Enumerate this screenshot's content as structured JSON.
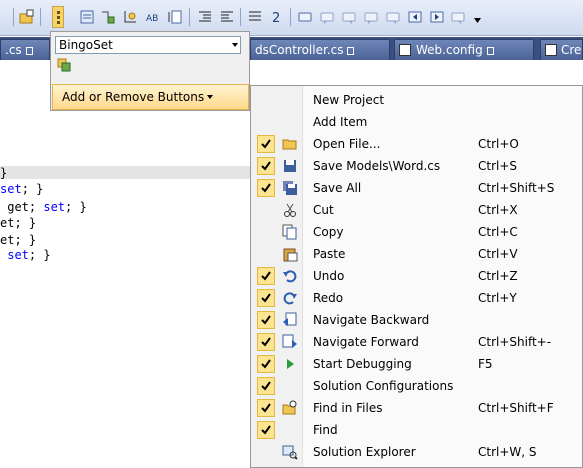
{
  "tabs": [
    {
      "label": ".cs"
    },
    {
      "label": "dsController.cs"
    },
    {
      "label": "Web.config"
    },
    {
      "label": "Cre"
    }
  ],
  "code_lines": [
    {
      "text": "}"
    },
    {
      "pre": "",
      "kw": "set",
      "post": "; }"
    },
    {
      "pre": " get; ",
      "kw": "set",
      "post": "; }"
    },
    {
      "pre": "et; }",
      "kw": "",
      "post": ""
    },
    {
      "pre": "et; }",
      "kw": "",
      "post": ""
    },
    {
      "pre": " ",
      "kw": "set",
      "post": "; }"
    }
  ],
  "panel": {
    "combo_value": "BingoSet",
    "add_remove_label": "Add or Remove Buttons"
  },
  "menu": {
    "items": [
      {
        "label": "New Project",
        "shortcut": "",
        "checked": false,
        "icon": ""
      },
      {
        "label": "Add Item",
        "shortcut": "",
        "checked": false,
        "icon": ""
      },
      {
        "label": "Open File...",
        "shortcut": "Ctrl+O",
        "checked": true,
        "icon": "open-folder-icon"
      },
      {
        "label": "Save Models\\Word.cs",
        "shortcut": "Ctrl+S",
        "checked": true,
        "icon": "save-icon"
      },
      {
        "label": "Save All",
        "shortcut": "Ctrl+Shift+S",
        "checked": true,
        "icon": "save-all-icon"
      },
      {
        "label": "Cut",
        "shortcut": "Ctrl+X",
        "checked": false,
        "icon": "cut-icon"
      },
      {
        "label": "Copy",
        "shortcut": "Ctrl+C",
        "checked": false,
        "icon": "copy-icon"
      },
      {
        "label": "Paste",
        "shortcut": "Ctrl+V",
        "checked": false,
        "icon": "paste-icon"
      },
      {
        "label": "Undo",
        "shortcut": "Ctrl+Z",
        "checked": true,
        "icon": "undo-icon"
      },
      {
        "label": "Redo",
        "shortcut": "Ctrl+Y",
        "checked": true,
        "icon": "redo-icon"
      },
      {
        "label": "Navigate Backward",
        "shortcut": "",
        "checked": true,
        "icon": "navigate-backward-icon"
      },
      {
        "label": "Navigate Forward",
        "shortcut": "Ctrl+Shift+-",
        "checked": true,
        "icon": "navigate-forward-icon"
      },
      {
        "label": "Start Debugging",
        "shortcut": "F5",
        "checked": true,
        "icon": "start-debugging-icon"
      },
      {
        "label": "Solution Configurations",
        "shortcut": "",
        "checked": true,
        "icon": ""
      },
      {
        "label": "Find in Files",
        "shortcut": "Ctrl+Shift+F",
        "checked": true,
        "icon": "find-in-files-icon"
      },
      {
        "label": "Find",
        "shortcut": "",
        "checked": true,
        "icon": ""
      },
      {
        "label": "Solution Explorer",
        "shortcut": "Ctrl+W, S",
        "checked": false,
        "icon": "solution-explorer-icon"
      }
    ]
  }
}
